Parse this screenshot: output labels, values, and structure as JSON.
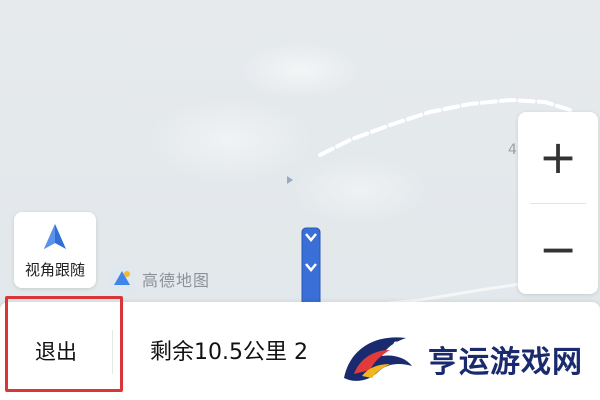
{
  "map": {
    "edge_label": "4",
    "route_color": "#3a6fd8",
    "track_color": "#ffffff"
  },
  "controls": {
    "zoom_in_label": "+",
    "zoom_out_label": "−",
    "view_follow_label": "视角跟随",
    "view_follow_icon": "compass-arrow-icon"
  },
  "brand": {
    "logo_text": "高德地图",
    "logo_icon": "amap-logo-icon"
  },
  "bottom_bar": {
    "exit_label": "退出",
    "remaining_text": "剩余10.5公里 2",
    "highlight_color": "#d9363a"
  },
  "watermark": {
    "text": "亨运游戏网"
  }
}
